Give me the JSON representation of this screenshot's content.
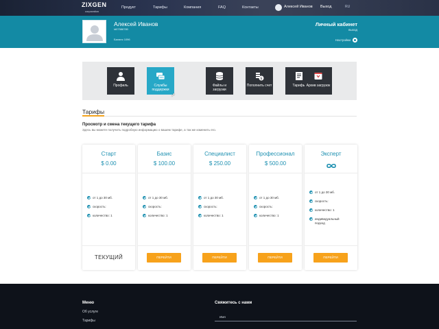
{
  "header": {
    "logo": "ZIXGEN",
    "logo_sub": "corporation",
    "nav": [
      "Продукт",
      "Тарифы",
      "Компания",
      "FAQ",
      "Контакты"
    ],
    "user_name": "Алексей Иванов",
    "exit": "Выход",
    "lang": "RU"
  },
  "profile": {
    "name": "Алексей Иванов",
    "uid": "id07586780",
    "balance": "Баланс 1096",
    "cabinet_title": "Личный кабинет",
    "exit": "выход",
    "settings": "Настройки"
  },
  "tiles": [
    {
      "label": "Профиль",
      "icon": "user-icon",
      "active": false
    },
    {
      "label": "Службы поддержки",
      "icon": "chat-icon",
      "active": true
    },
    {
      "label": "Файлы и загрузки",
      "icon": "database-icon",
      "active": false
    },
    {
      "label": "Пополнить счет",
      "icon": "coins-icon",
      "active": false
    },
    {
      "label": "Тарифы",
      "icon": "document-icon",
      "active": false
    },
    {
      "label": "Архив загрузок",
      "icon": "archive-icon",
      "active": false
    }
  ],
  "tariffs": {
    "section_title": "Тарифы",
    "subtitle": "Просмотр и смена текущего тарифа",
    "description": "Здесь вы можете получить подробную информацию о вашем тарифе, а так же изменить его.",
    "plans": [
      {
        "name": "Старт",
        "price": "$ 0.00",
        "features": [
          "от 1 до 30 мб.",
          "скорость:",
          "количество: 1"
        ],
        "action": "ТЕКУЩИЙ",
        "current": true
      },
      {
        "name": "Базис",
        "price": "$ 100.00",
        "features": [
          "от 1 до 30 мб.",
          "скорость:",
          "количество: 1"
        ],
        "action": "ПЕРЕЙТИ",
        "current": false
      },
      {
        "name": "Специалист",
        "price": "$ 250.00",
        "features": [
          "от 1 до 30 мб.",
          "скорость:",
          "количество: 1"
        ],
        "action": "ПЕРЕЙТИ",
        "current": false
      },
      {
        "name": "Профессионал",
        "price": "$ 500.00",
        "features": [
          "от 1 до 30 мб.",
          "скорость:",
          "количество: 1"
        ],
        "action": "ПЕРЕЙТИ",
        "current": false
      },
      {
        "name": "Эксперт",
        "price": "",
        "price_icon": "infinity-icon",
        "features": [
          "от 1 до 30 мб.",
          "скорость:",
          "количество: 1",
          "индивидуальный подход"
        ],
        "action": "ПЕРЕЙТИ",
        "current": false
      }
    ]
  },
  "footer": {
    "menu_title": "Меню",
    "links": [
      "Об услуге",
      "Тарифы"
    ],
    "contact_title": "Свяжитесь с нами",
    "name_label": "Имя"
  },
  "colors": {
    "band": "#138aa4",
    "accent": "#f7a21b",
    "tile_active": "#27a8c7",
    "tile": "#2e3238"
  }
}
